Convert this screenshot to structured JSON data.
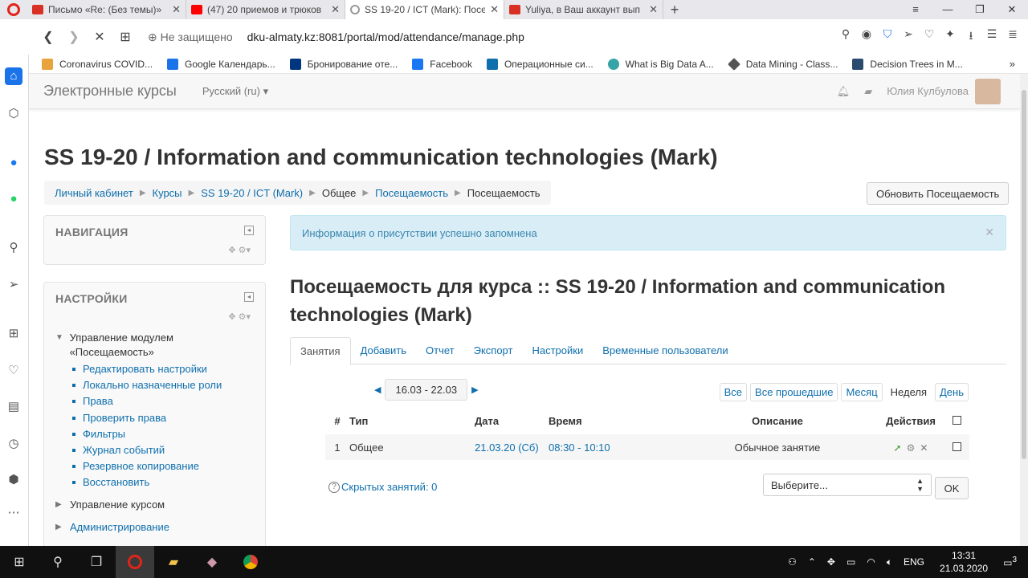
{
  "browser": {
    "tabs": [
      {
        "title": "Письмо «Re: (Без темы)»",
        "color": "#d93025"
      },
      {
        "title": "(47) 20 приемов и трюков",
        "color": "#ff0000"
      },
      {
        "title": "SS 19-20 / ICT (Mark): Посе",
        "color": "#999999"
      },
      {
        "title": "Yuliya, в Ваш аккаунт вып",
        "color": "#d93025"
      }
    ],
    "security_label": "Не защищено",
    "url": "dku-almaty.kz:8081/portal/mod/attendance/manage.php",
    "bookmarks": [
      {
        "label": "Coronavirus COVID...",
        "color": "#e8a33c"
      },
      {
        "label": "Google Календарь...",
        "color": "#1a73e8"
      },
      {
        "label": "Бронирование оте...",
        "color": "#003580"
      },
      {
        "label": "Facebook",
        "color": "#1877f2"
      },
      {
        "label": "Операционные си...",
        "color": "#0f6fad"
      },
      {
        "label": "What is Big Data A...",
        "color": "#36a3a6"
      },
      {
        "label": "Data Mining - Class...",
        "color": "#555555"
      },
      {
        "label": "Decision Trees in M...",
        "color": "#2b4a6f"
      }
    ]
  },
  "site": {
    "brand": "Электронные курсы",
    "language": "Русский (ru)",
    "user_name": "Юлия Кулбулова",
    "course_title": "SS 19-20 / Information and communication technologies (Mark)",
    "breadcrumb": {
      "items": [
        "Личный кабинет",
        "Курсы",
        "SS 19-20 / ICT (Mark)",
        "Общее",
        "Посещаемость",
        "Посещаемость"
      ]
    },
    "update_button": "Обновить Посещаемость",
    "navigation_block": {
      "title": "НАВИГАЦИЯ"
    },
    "settings_block": {
      "title": "НАСТРОЙКИ",
      "module_node": "Управление модулем «Посещаемость»",
      "module_items": [
        "Редактировать настройки",
        "Локально назначенные роли",
        "Права",
        "Проверить права",
        "Фильтры",
        "Журнал событий",
        "Резервное копирование",
        "Восстановить"
      ],
      "course_node": "Управление курсом",
      "admin_node": "Администрирование"
    },
    "alert": "Информация о присутствии успешно запомнена",
    "page_heading": "Посещаемость для курса :: SS 19-20 / Information and communication technologies (Mark)",
    "tabs": [
      "Занятия",
      "Добавить",
      "Отчет",
      "Экспорт",
      "Настройки",
      "Временные пользователи"
    ],
    "date_range": "16.03 - 22.03",
    "view_buttons": [
      "Все",
      "Все прошедшие",
      "Месяц",
      "Неделя",
      "День"
    ],
    "table": {
      "headers": [
        "#",
        "Тип",
        "Дата",
        "Время",
        "Описание",
        "Действия"
      ],
      "rows": [
        {
          "num": "1",
          "type": "Общее",
          "date": "21.03.20 (Сб)",
          "time": "08:30 - 10:10",
          "description": "Обычное занятие"
        }
      ]
    },
    "hidden_sessions": "Скрытых занятий: 0",
    "select_placeholder": "Выберите...",
    "ok_button": "OK"
  },
  "taskbar": {
    "language": "ENG",
    "time": "13:31",
    "date": "21.03.2020",
    "notifications": "3"
  }
}
